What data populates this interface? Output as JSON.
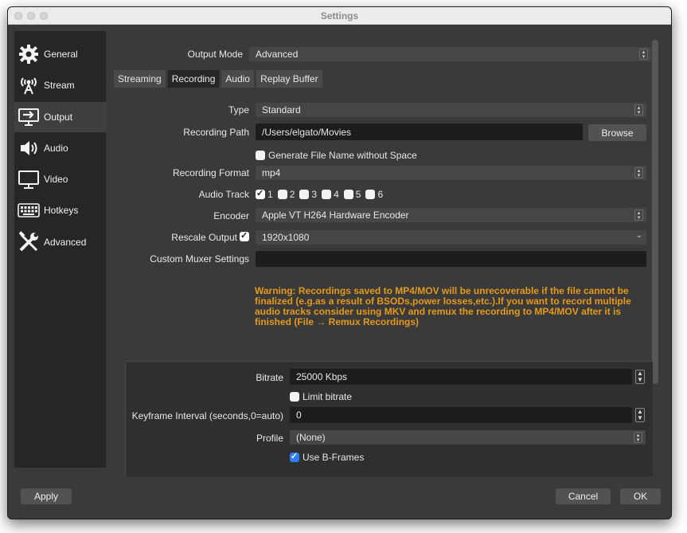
{
  "window": {
    "title": "Settings"
  },
  "sidebar": {
    "items": [
      {
        "label": "General",
        "icon": "gear-icon"
      },
      {
        "label": "Stream",
        "icon": "broadcast-antenna-icon"
      },
      {
        "label": "Output",
        "icon": "output-monitor-icon",
        "active": true
      },
      {
        "label": "Audio",
        "icon": "speaker-icon"
      },
      {
        "label": "Video",
        "icon": "monitor-icon"
      },
      {
        "label": "Hotkeys",
        "icon": "keyboard-icon"
      },
      {
        "label": "Advanced",
        "icon": "tools-icon"
      }
    ]
  },
  "output_mode": {
    "label": "Output Mode",
    "value": "Advanced"
  },
  "tabs": [
    "Streaming",
    "Recording",
    "Audio",
    "Replay Buffer"
  ],
  "recording": {
    "type": {
      "label": "Type",
      "value": "Standard"
    },
    "path": {
      "label": "Recording Path",
      "value": "/Users/elgato/Movies",
      "browse_label": "Browse"
    },
    "generate_name": {
      "label": "Generate File Name without Space",
      "checked": false
    },
    "format": {
      "label": "Recording Format",
      "value": "mp4"
    },
    "audio_track": {
      "label": "Audio Track",
      "tracks": [
        "1",
        "2",
        "3",
        "4",
        "5",
        "6"
      ],
      "checked": [
        true,
        false,
        false,
        false,
        false,
        false
      ]
    },
    "encoder": {
      "label": "Encoder",
      "value": "Apple VT H264 Hardware Encoder"
    },
    "rescale": {
      "label": "Rescale Output",
      "checked": true,
      "value": "1920x1080"
    },
    "muxer": {
      "label": "Custom Muxer Settings",
      "value": ""
    },
    "warning": "Warning: Recordings saved to MP4/MOV will be unrecoverable if the file cannot be finalized (e.g.as a result of BSODs,power losses,etc.).If you want to record multiple audio tracks consider using MKV and remux the recording to MP4/MOV after it is finished (File → Remux Recordings)"
  },
  "encoder_settings": {
    "bitrate": {
      "label": "Bitrate",
      "value": "25000 Kbps"
    },
    "limit_bitrate": {
      "label": "Limit bitrate",
      "checked": false
    },
    "keyframe": {
      "label": "Keyframe Interval (seconds,0=auto)",
      "value": "0"
    },
    "profile": {
      "label": "Profile",
      "value": "(None)"
    },
    "bframes": {
      "label": "Use B-Frames",
      "checked": true
    }
  },
  "buttons": {
    "apply": "Apply",
    "cancel": "Cancel",
    "ok": "OK"
  },
  "colors": {
    "warning": "#e49a1b",
    "accent": "#2f7cf6",
    "background": "#3a3a3a",
    "sidebar": "#262626"
  }
}
